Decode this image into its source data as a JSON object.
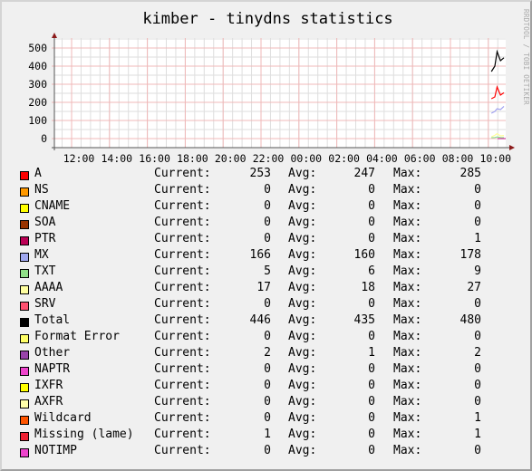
{
  "window": {
    "watermark": "RRDTOOL / TOBI OETIKER"
  },
  "chart_data": {
    "type": "line",
    "title": "kimber - tinydns statistics",
    "xlabel": "",
    "ylabel": "",
    "ylim": [
      0,
      550
    ],
    "yticks": [
      "0",
      "100",
      "200",
      "300",
      "400",
      "500"
    ],
    "ytick_values": [
      0,
      100,
      200,
      300,
      400,
      500
    ],
    "xticks": [
      "12:00",
      "14:00",
      "16:00",
      "18:00",
      "20:00",
      "22:00",
      "00:00",
      "02:00",
      "04:00",
      "06:00",
      "08:00",
      "10:00"
    ],
    "x_range_hours": [
      11.5,
      11.2
    ],
    "grid": true,
    "legend_placement": "bottom",
    "note": "Data only present in the last ~30 minutes at the right edge of the graph",
    "series": [
      {
        "name": "Total",
        "color": "#000000",
        "points": [
          [
            10.4,
            370
          ],
          [
            10.55,
            400
          ],
          [
            10.65,
            480
          ],
          [
            10.8,
            430
          ],
          [
            10.95,
            446
          ]
        ]
      },
      {
        "name": "A",
        "color": "#ff0000",
        "points": [
          [
            10.4,
            220
          ],
          [
            10.55,
            230
          ],
          [
            10.65,
            285
          ],
          [
            10.8,
            240
          ],
          [
            10.95,
            253
          ]
        ]
      },
      {
        "name": "MX",
        "color": "#a0a0f0",
        "points": [
          [
            10.4,
            140
          ],
          [
            10.55,
            150
          ],
          [
            10.65,
            165
          ],
          [
            10.8,
            160
          ],
          [
            10.95,
            178
          ]
        ]
      },
      {
        "name": "AAAA",
        "color": "#ffff99",
        "points": [
          [
            10.4,
            10
          ],
          [
            10.55,
            18
          ],
          [
            10.65,
            27
          ],
          [
            10.8,
            15
          ],
          [
            10.95,
            17
          ]
        ]
      },
      {
        "name": "TXT",
        "color": "#90e090",
        "points": [
          [
            10.4,
            5
          ],
          [
            10.55,
            6
          ],
          [
            10.65,
            9
          ],
          [
            10.8,
            6
          ],
          [
            10.95,
            5
          ]
        ]
      }
    ]
  },
  "legend": {
    "current_label": "Current:",
    "avg_label": "Avg:",
    "max_label": "Max:",
    "rows": [
      {
        "name": "A",
        "color": "#ff0000",
        "current": "253",
        "avg": "247",
        "max": "285"
      },
      {
        "name": "NS",
        "color": "#ff9900",
        "current": "0",
        "avg": "0",
        "max": "0"
      },
      {
        "name": "CNAME",
        "color": "#ffff00",
        "current": "0",
        "avg": "0",
        "max": "0"
      },
      {
        "name": "SOA",
        "color": "#993300",
        "current": "0",
        "avg": "0",
        "max": "0"
      },
      {
        "name": "PTR",
        "color": "#bb0055",
        "current": "0",
        "avg": "0",
        "max": "1"
      },
      {
        "name": "MX",
        "color": "#a0a8f0",
        "current": "166",
        "avg": "160",
        "max": "178"
      },
      {
        "name": "TXT",
        "color": "#90e088",
        "current": "5",
        "avg": "6",
        "max": "9"
      },
      {
        "name": "AAAA",
        "color": "#ffffa0",
        "current": "17",
        "avg": "18",
        "max": "27"
      },
      {
        "name": "SRV",
        "color": "#ff5070",
        "current": "0",
        "avg": "0",
        "max": "0"
      },
      {
        "name": "Total",
        "color": "#000000",
        "current": "446",
        "avg": "435",
        "max": "480"
      },
      {
        "name": "Format Error",
        "color": "#ffff66",
        "current": "0",
        "avg": "0",
        "max": "0"
      },
      {
        "name": "Other",
        "color": "#9944aa",
        "current": "2",
        "avg": "1",
        "max": "2"
      },
      {
        "name": "NAPTR",
        "color": "#ee44cc",
        "current": "0",
        "avg": "0",
        "max": "0"
      },
      {
        "name": "IXFR",
        "color": "#ffff00",
        "current": "0",
        "avg": "0",
        "max": "0"
      },
      {
        "name": "AXFR",
        "color": "#ffffaa",
        "current": "0",
        "avg": "0",
        "max": "0"
      },
      {
        "name": "Wildcard",
        "color": "#ff5500",
        "current": "0",
        "avg": "0",
        "max": "1"
      },
      {
        "name": "Missing (lame)",
        "color": "#ee2233",
        "current": "1",
        "avg": "0",
        "max": "1"
      },
      {
        "name": "NOTIMP",
        "color": "#ee44cc",
        "current": "0",
        "avg": "0",
        "max": "0"
      }
    ]
  }
}
